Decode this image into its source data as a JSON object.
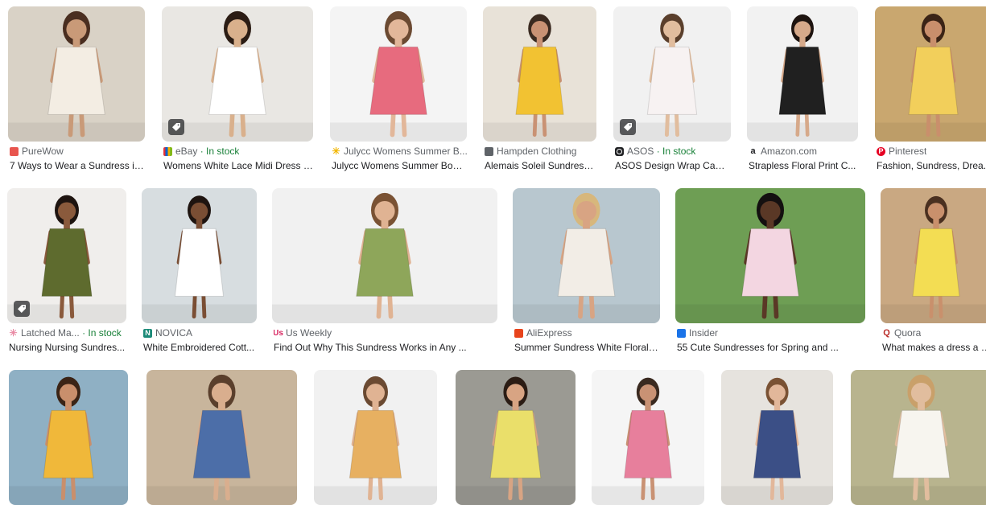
{
  "results": [
    {
      "source": "PureWow",
      "stock": "",
      "title": "7 Ways to Wear a Sundress in ...",
      "favicon_color": "#e8554e",
      "favicon": "tile",
      "bg": "#d9d2c6",
      "dress": "#f3ede3",
      "skin": "#c99a78",
      "hair": "#4a2e20",
      "badge": false
    },
    {
      "source": "eBay",
      "stock": "· In stock",
      "title": "Womens White Lace Midi Dress V...",
      "favicon_color": "#e53238",
      "favicon": "multicolor",
      "bg": "#e9e7e3",
      "dress": "#ffffff",
      "skin": "#d9b08c",
      "hair": "#2b1c14",
      "badge": true
    },
    {
      "source": "Julycc Womens Summer B...",
      "stock": "",
      "title": "Julycc Womens Summer Bohe...",
      "favicon_color": "#f2b705",
      "favicon": "spark",
      "bg": "#f4f4f4",
      "dress": "#e76b7e",
      "skin": "#e2b79a",
      "hair": "#6b4a32",
      "badge": false
    },
    {
      "source": "Hampden Clothing",
      "stock": "",
      "title": "Alemais Soleil Sundress ...",
      "favicon_color": "#5f6368",
      "favicon": "tile",
      "bg": "#e8e2d8",
      "dress": "#f2c232",
      "skin": "#c99274",
      "hair": "#3a2a20",
      "badge": false
    },
    {
      "source": "ASOS",
      "stock": "· In stock",
      "title": "ASOS Design Wrap Cami ...",
      "favicon_color": "#202124",
      "favicon": "ring",
      "bg": "#f1f1f1",
      "dress": "#f7f2f2",
      "skin": "#e1bd9e",
      "hair": "#5a3f2c",
      "badge": true
    },
    {
      "source": "Amazon.com",
      "stock": "",
      "title": "Strapless Floral Print C...",
      "favicon_color": "#ff9900",
      "favicon": "amazon",
      "bg": "#f2f2f2",
      "dress": "#202020",
      "skin": "#d6a98a",
      "hair": "#1e1410",
      "badge": false
    },
    {
      "source": "Pinterest",
      "stock": "",
      "title": "Fashion, Sundress, Drea...",
      "favicon_color": "#e60023",
      "favicon": "p",
      "bg": "#c9a76f",
      "dress": "#f2cf5b",
      "skin": "#c98f6c",
      "hair": "#3b2416",
      "badge": false
    },
    {
      "source": "Latched Ma...",
      "stock": "· In stock",
      "title": "Nursing Nursing Sundres...",
      "favicon_color": "#e98aa4",
      "favicon": "spark",
      "bg": "#f0eeec",
      "dress": "#5e6b2e",
      "skin": "#8a5a3c",
      "hair": "#1e1410",
      "badge": true
    },
    {
      "source": "NOVICA",
      "stock": "",
      "title": "White Embroidered Cott...",
      "favicon_color": "#1b8a78",
      "favicon": "n",
      "bg": "#d7dde0",
      "dress": "#ffffff",
      "skin": "#7a4e34",
      "hair": "#1e1410",
      "badge": false
    },
    {
      "source": "Us Weekly",
      "stock": "",
      "title": "Find Out Why This Sundress Works in Any ...",
      "favicon_color": "#d6205c",
      "favicon": "us",
      "bg": "#f1f1f1",
      "dress": "#8ea65a",
      "skin": "#e0b393",
      "hair": "#7a5234",
      "badge": false
    },
    {
      "source": "AliExpress",
      "stock": "",
      "title": "Summer Sundress White Floral E...",
      "favicon_color": "#e8441c",
      "favicon": "tile",
      "bg": "#b8c7cf",
      "dress": "#f2ede6",
      "skin": "#d8a483",
      "hair": "#d7b77c",
      "badge": false
    },
    {
      "source": "Insider",
      "stock": "",
      "title": "55 Cute Sundresses for Spring and ...",
      "favicon_color": "#1a73e8",
      "favicon": "tile",
      "bg": "#6e9e54",
      "dress": "#f3d6e1",
      "skin": "#5a3826",
      "hair": "#141010",
      "badge": false
    },
    {
      "source": "Quora",
      "stock": "",
      "title": "What makes a dress a s...",
      "favicon_color": "#b92b27",
      "favicon": "q",
      "bg": "#c9a882",
      "dress": "#f3dd53",
      "skin": "#c9906c",
      "hair": "#4a3020",
      "badge": false
    },
    {
      "source": "",
      "stock": "",
      "title": "",
      "favicon_color": "#ffffff",
      "favicon": "none",
      "bg": "#8fb0c4",
      "dress": "#f0b83a",
      "skin": "#c98f6c",
      "hair": "#3b2416",
      "badge": false
    },
    {
      "source": "",
      "stock": "",
      "title": "",
      "favicon_color": "#ffffff",
      "favicon": "none",
      "bg": "#c8b59c",
      "dress": "#4c6ea8",
      "skin": "#d9ae8e",
      "hair": "#5a3f2c",
      "badge": false
    },
    {
      "source": "",
      "stock": "",
      "title": "",
      "favicon_color": "#ffffff",
      "favicon": "none",
      "bg": "#f1f1f1",
      "dress": "#e7b061",
      "skin": "#e0b393",
      "hair": "#6b4a32",
      "badge": false
    },
    {
      "source": "",
      "stock": "",
      "title": "",
      "favicon_color": "#ffffff",
      "favicon": "none",
      "bg": "#9b9a93",
      "dress": "#eadf6a",
      "skin": "#d8a483",
      "hair": "#2b1c14",
      "badge": false
    },
    {
      "source": "",
      "stock": "",
      "title": "",
      "favicon_color": "#ffffff",
      "favicon": "none",
      "bg": "#f5f5f5",
      "dress": "#e77f9c",
      "skin": "#c99274",
      "hair": "#3a2a20",
      "badge": false
    },
    {
      "source": "",
      "stock": "",
      "title": "",
      "favicon_color": "#ffffff",
      "favicon": "none",
      "bg": "#e6e3de",
      "dress": "#3b4f86",
      "skin": "#e2b79a",
      "hair": "#7a5234",
      "badge": false
    },
    {
      "source": "",
      "stock": "",
      "title": "",
      "favicon_color": "#ffffff",
      "favicon": "none",
      "bg": "#b8b48e",
      "dress": "#f7f5ef",
      "skin": "#e1bd9e",
      "hair": "#c9a06a",
      "badge": false
    }
  ]
}
